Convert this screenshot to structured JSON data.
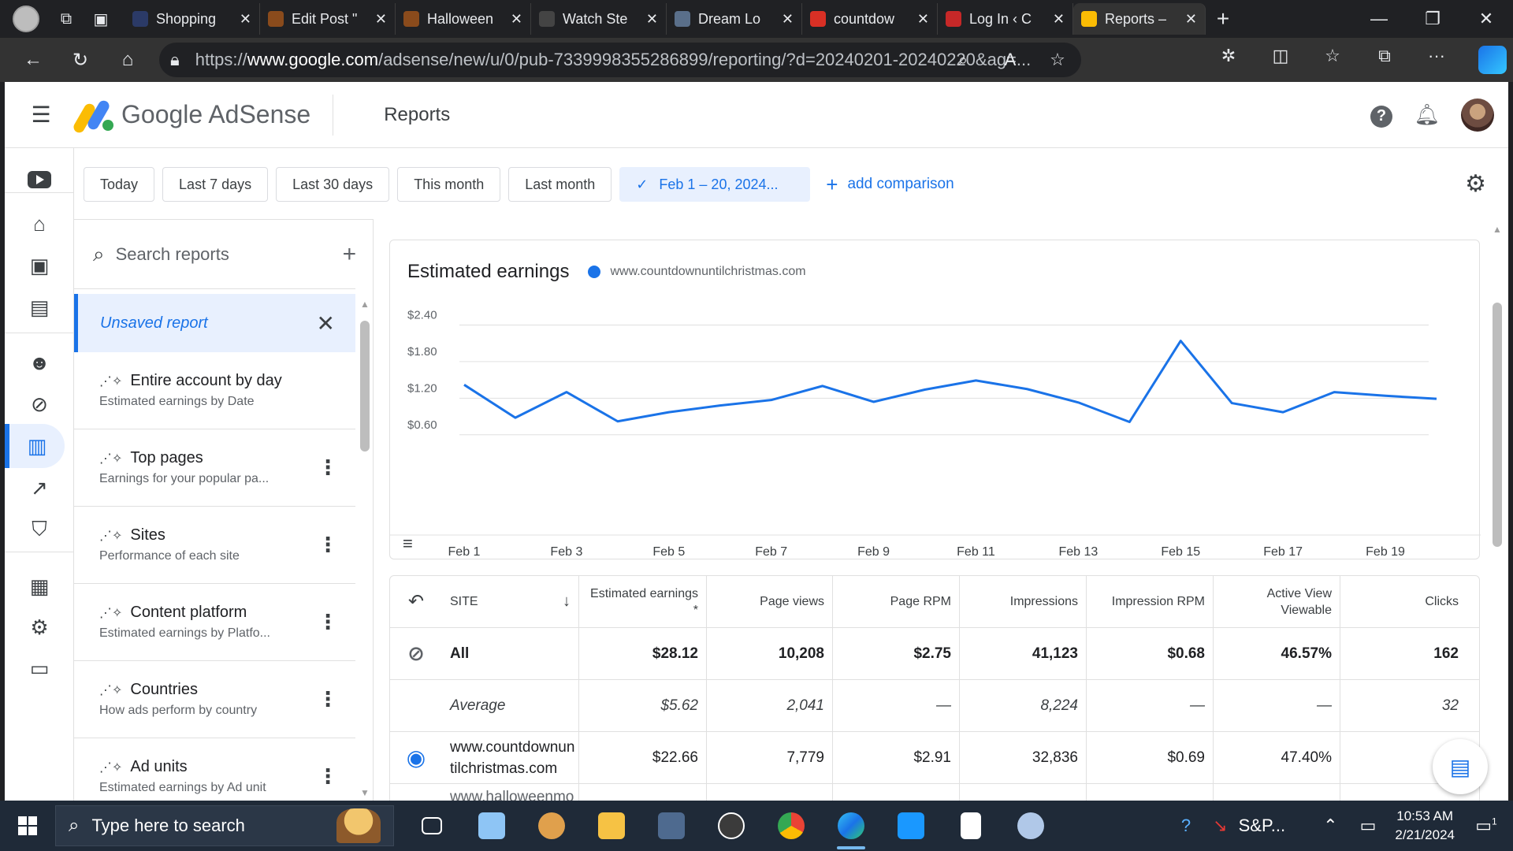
{
  "browser": {
    "tabs": [
      {
        "title": "Shopping",
        "color": "#2b3a67"
      },
      {
        "title": "Edit Post \"",
        "color": "#8a4b1c"
      },
      {
        "title": "Halloween",
        "color": "#8a4b1c"
      },
      {
        "title": "Watch Ste",
        "color": "#444444"
      },
      {
        "title": "Dream Lo",
        "color": "#5a6f8a"
      },
      {
        "title": "countdow",
        "color": "#d93025"
      },
      {
        "title": "Log In ‹ C",
        "color": "#c62828"
      },
      {
        "title": "Reports –",
        "color": "#fbbc04"
      }
    ],
    "url_prefix": "https://",
    "url_domain": "www.google.com",
    "url_rest": "/adsense/new/u/0/pub-7339998355286899/reporting/?d=20240201-20240220&ag=..."
  },
  "app": {
    "name": "Google AdSense",
    "page_title": "Reports"
  },
  "date_chips": [
    "Today",
    "Last 7 days",
    "Last 30 days",
    "This month",
    "Last month"
  ],
  "selected_range": "Feb 1 – 20, 2024...",
  "add_comparison": "add comparison",
  "sidebar": {
    "search_placeholder": "Search reports",
    "unsaved": "Unsaved report",
    "reports": [
      {
        "title": "Entire account by day",
        "sub": "Estimated earnings by Date",
        "more": false
      },
      {
        "title": "Top pages",
        "sub": "Earnings for your popular pa...",
        "more": true
      },
      {
        "title": "Sites",
        "sub": "Performance of each site",
        "more": true
      },
      {
        "title": "Content platform",
        "sub": "Estimated earnings by Platfo...",
        "more": true
      },
      {
        "title": "Countries",
        "sub": "How ads perform by country",
        "more": true
      },
      {
        "title": "Ad units",
        "sub": "Estimated earnings by Ad unit",
        "more": true
      }
    ]
  },
  "chart": {
    "title": "Estimated earnings",
    "legend": "www.countdownuntilchristmas.com",
    "color": "#1a73e8"
  },
  "chart_data": {
    "type": "line",
    "title": "Estimated earnings",
    "x": [
      "Feb 1",
      "Feb 2",
      "Feb 3",
      "Feb 4",
      "Feb 5",
      "Feb 6",
      "Feb 7",
      "Feb 8",
      "Feb 9",
      "Feb 10",
      "Feb 11",
      "Feb 12",
      "Feb 13",
      "Feb 14",
      "Feb 15",
      "Feb 16",
      "Feb 17",
      "Feb 18",
      "Feb 19",
      "Feb 20"
    ],
    "x_tick_labels": [
      "Feb 1",
      "Feb 3",
      "Feb 5",
      "Feb 7",
      "Feb 9",
      "Feb 11",
      "Feb 13",
      "Feb 15",
      "Feb 17",
      "Feb 19"
    ],
    "y_tick_labels": [
      "$0.60",
      "$1.20",
      "$1.80",
      "$2.40"
    ],
    "ylim": [
      0.3,
      2.6
    ],
    "series": [
      {
        "name": "www.countdownuntilchristmas.com",
        "values": [
          1.42,
          0.88,
          1.3,
          0.82,
          0.97,
          1.08,
          1.17,
          1.4,
          1.14,
          1.34,
          1.49,
          1.35,
          1.13,
          0.81,
          2.14,
          1.12,
          0.97,
          1.3,
          1.24,
          1.19
        ]
      }
    ],
    "grid": true
  },
  "table": {
    "headers": {
      "site": "SITE",
      "earnings": "Estimated earnings *",
      "page_views": "Page views",
      "page_rpm": "Page RPM",
      "impressions": "Impressions",
      "impression_rpm": "Impression RPM",
      "active_view": "Active View Viewable",
      "clicks": "Clicks"
    },
    "rows": [
      {
        "site": "All",
        "earnings": "$28.12",
        "page_views": "10,208",
        "page_rpm": "$2.75",
        "impressions": "41,123",
        "impression_rpm": "$0.68",
        "active_view": "46.57%",
        "clicks": "162"
      },
      {
        "site": "Average",
        "earnings": "$5.62",
        "page_views": "2,041",
        "page_rpm": "—",
        "impressions": "8,224",
        "impression_rpm": "—",
        "active_view": "—",
        "clicks": "32"
      },
      {
        "site": "www.countdownuntilchristmas.com",
        "site_line1": "www.countdownun",
        "site_line2": "tilchristmas.com",
        "earnings": "$22.66",
        "page_views": "7,779",
        "page_rpm": "$2.91",
        "impressions": "32,836",
        "impression_rpm": "$0.69",
        "active_view": "47.40%",
        "clicks": ""
      },
      {
        "site": "www.halloweenmo",
        "earnings": "",
        "page_views": "",
        "page_rpm": "",
        "impressions": "",
        "impression_rpm": "",
        "active_view": "",
        "clicks": ""
      }
    ]
  },
  "taskbar": {
    "search_placeholder": "Type here to search",
    "stock": "S&P...",
    "time": "10:53 AM",
    "date": "2/21/2024",
    "notifications": "1"
  }
}
